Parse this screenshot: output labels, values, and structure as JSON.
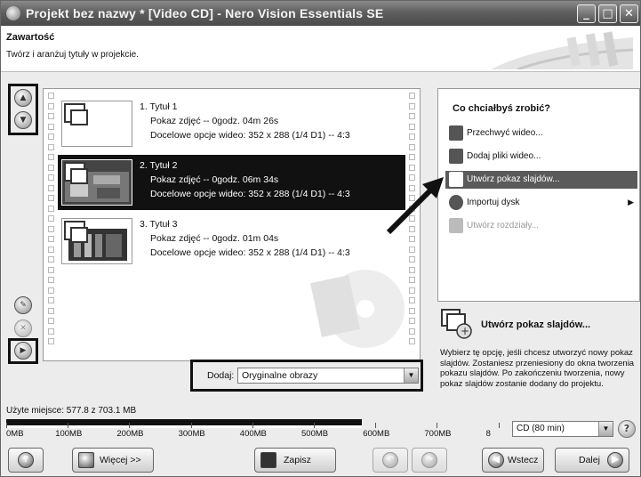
{
  "window": {
    "title": "Projekt bez nazwy * [Video CD] - Nero Vision Essentials SE"
  },
  "header": {
    "title": "Zawartość",
    "subtitle": "Twórz i aranżuj tytuły w projekcie."
  },
  "titles": [
    {
      "name": "1. Tytuł 1",
      "info": "Pokaz zdjęć -- 0godz. 04m 26s",
      "options": "Docelowe opcje wideo: 352 x 288 (1/4 D1) -- 4:3",
      "selected": false
    },
    {
      "name": "2. Tytuł 2",
      "info": "Pokaz zdjęć -- 0godz. 06m 34s",
      "options": "Docelowe opcje wideo: 352 x 288 (1/4 D1) -- 4:3",
      "selected": true
    },
    {
      "name": "3. Tytuł 3",
      "info": "Pokaz zdjęć -- 0godz. 01m 04s",
      "options": "Docelowe opcje wideo: 352 x 288 (1/4 D1) -- 4:3",
      "selected": false
    }
  ],
  "add": {
    "label": "Dodaj:",
    "value": "Oryginalne obrazy"
  },
  "actions": {
    "question": "Co chciałbyś zrobić?",
    "items": [
      {
        "label": "Przechwyć wideo...",
        "state": "normal"
      },
      {
        "label": "Dodaj pliki wideo...",
        "state": "normal"
      },
      {
        "label": "Utwórz pokaz slajdów...",
        "state": "selected"
      },
      {
        "label": "Importuj dysk",
        "state": "normal",
        "submenu": true
      },
      {
        "label": "Utwórz rozdziały...",
        "state": "disabled"
      }
    ]
  },
  "description": {
    "title": "Utwórz pokaz slajdów...",
    "text": "Wybierz tę opcję, jeśli chcesz utworzyć nowy pokaz slajdów. Zostaniesz przeniesiony do okna tworzenia pokazu slajdów. Po zakończeniu tworzenia, nowy pokaz slajdów zostanie dodany do projektu."
  },
  "space": {
    "used_label": "Użyte miejsce: 577.8 z 703.1 MB",
    "used_mb": 577.8,
    "capacity_mb": 703.1,
    "ticks": [
      "0MB",
      "100MB",
      "200MB",
      "300MB",
      "400MB",
      "500MB",
      "600MB",
      "700MB",
      "8"
    ],
    "disc": "CD (80 min)"
  },
  "buttons": {
    "more": "Więcej >>",
    "save": "Zapisz",
    "back": "Wstecz",
    "next": "Dalej"
  }
}
